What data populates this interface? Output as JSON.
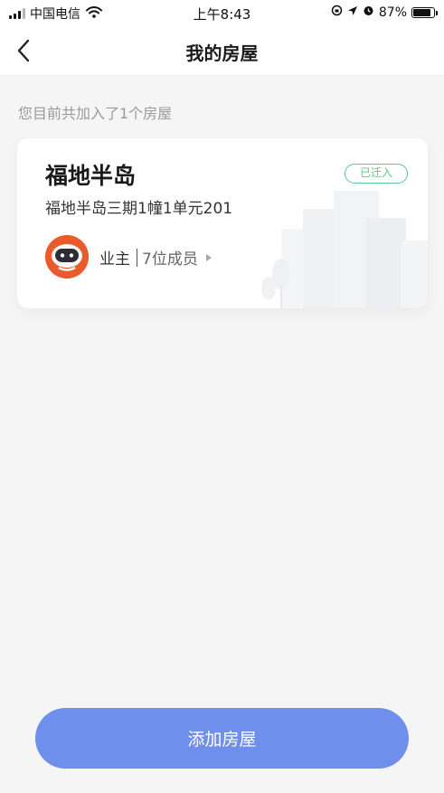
{
  "status_bar": {
    "carrier": "中国电信",
    "time": "上午8:43",
    "battery": "87%",
    "battery_level": 0.87
  },
  "nav": {
    "title": "我的房屋"
  },
  "summary_text": "您目前共加入了1个房屋",
  "house": {
    "name": "福地半岛",
    "address": "福地半岛三期1幢1单元201",
    "status_badge": "已迁入",
    "role": "业主",
    "member_count": "7位成员"
  },
  "add_button_label": "添加房屋",
  "colors": {
    "accent_button": "#6e90ec",
    "badge_green": "#5cc88a",
    "avatar_orange": "#ea5b2c"
  },
  "icons": {
    "back": "chevron-left-icon",
    "member_arrow": "triangle-right-icon"
  }
}
